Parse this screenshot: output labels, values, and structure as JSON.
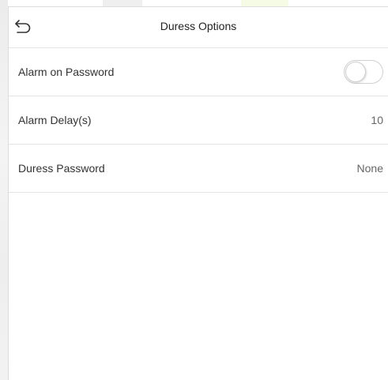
{
  "header": {
    "title": "Duress Options",
    "back_icon": "back-arrow-icon"
  },
  "rows": [
    {
      "label": "Alarm on Password",
      "control": "toggle",
      "state": "off"
    },
    {
      "label": "Alarm Delay(s)",
      "value": "10"
    },
    {
      "label": "Duress Password",
      "value": "None"
    }
  ],
  "colors": {
    "divider": "#e3e3e3",
    "text": "#333333",
    "value_text": "#666666",
    "toggle_border": "#cfcfcf"
  }
}
